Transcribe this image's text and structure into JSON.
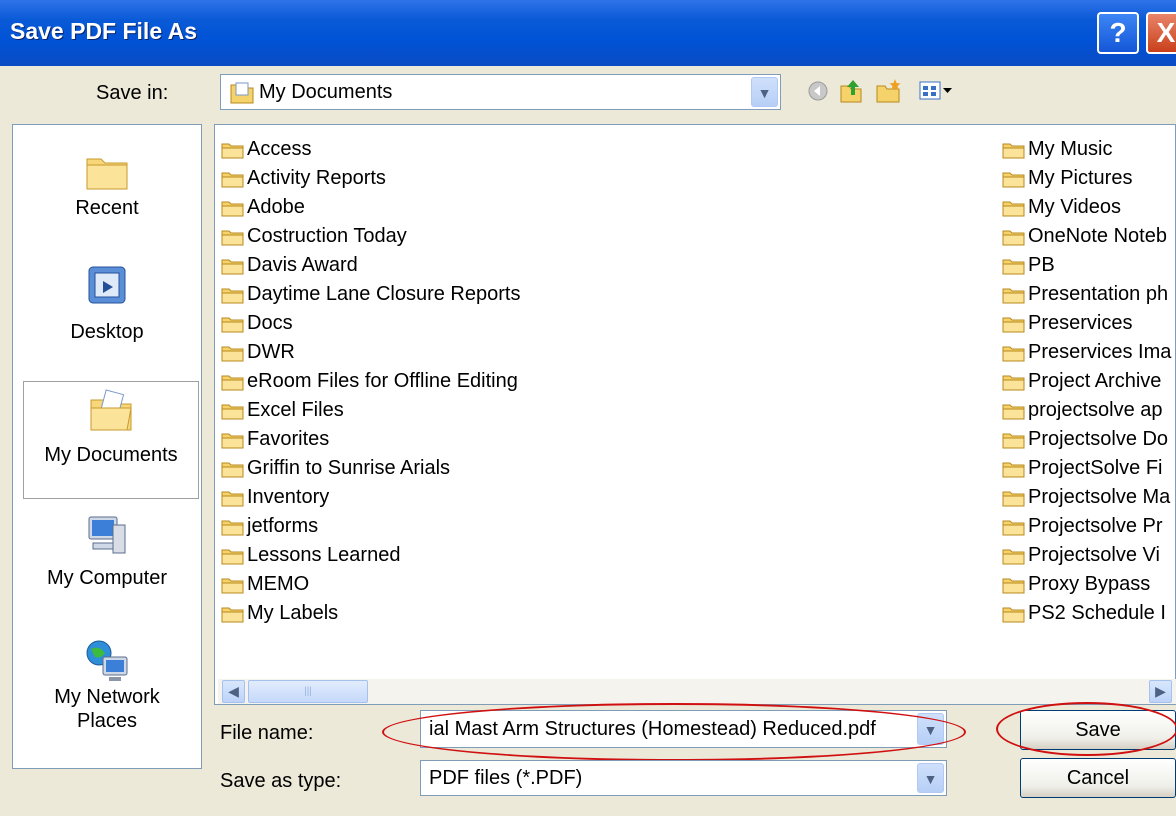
{
  "window": {
    "title": "Save PDF File As",
    "help_label": "?",
    "close_label": "X"
  },
  "save_in": {
    "label": "Save in:",
    "value": "My Documents"
  },
  "places": [
    {
      "label": "Recent"
    },
    {
      "label": "Desktop"
    },
    {
      "label": "My Documents"
    },
    {
      "label": "My Computer"
    },
    {
      "label": "My Network Places"
    }
  ],
  "files_left": [
    "Access",
    "Activity Reports",
    "Adobe",
    "Costruction Today",
    "Davis Award",
    "Daytime Lane Closure Reports",
    "Docs",
    "DWR",
    "eRoom Files for Offline Editing",
    "Excel Files",
    "Favorites",
    "Griffin to Sunrise Arials",
    "Inventory",
    "jetforms",
    "Lessons Learned",
    "MEMO",
    "My Labels"
  ],
  "files_right": [
    "My Music",
    "My Pictures",
    "My Videos",
    "OneNote Noteb",
    "PB",
    "Presentation ph",
    "Preservices",
    "Preservices Ima",
    "Project Archive",
    "projectsolve ap",
    "Projectsolve Do",
    "ProjectSolve Fi",
    "Projectsolve Ma",
    "Projectsolve Pr",
    "Projectsolve Vi",
    "Proxy Bypass",
    "PS2 Schedule I"
  ],
  "file_name": {
    "label": "File name:",
    "value": "ial Mast Arm Structures (Homestead) Reduced.pdf"
  },
  "save_type": {
    "label": "Save as type:",
    "value": "PDF files (*.PDF)"
  },
  "buttons": {
    "save": "Save",
    "cancel": "Cancel"
  },
  "colors": {
    "titlebar": "#0053d6",
    "annotation": "#d01010",
    "folder": "#f5d26a"
  }
}
